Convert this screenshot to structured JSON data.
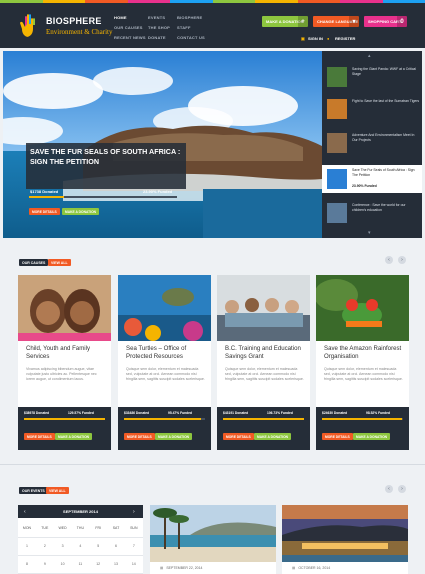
{
  "brand": {
    "name": "BIOSPHERE",
    "tagline": "Environment & Charity"
  },
  "colors": {
    "dark": "#252d38",
    "accent": "#f5b400",
    "green": "#8dc63f",
    "orange": "#f15a24",
    "pink": "#e8318c",
    "stripe": [
      "#8dc63f",
      "#f5b400",
      "#f15a24",
      "#e8318c",
      "#1da1f2",
      "#8dc63f",
      "#f5b400",
      "#f15a24",
      "#e8318c",
      "#1da1f2"
    ]
  },
  "nav": {
    "col1": [
      "HOME",
      "OUR CAUSES",
      "RECENT NEWS"
    ],
    "col2": [
      "EVENTS",
      "THE SHOP",
      "DONATE"
    ],
    "col3": [
      "BIOSPHERE",
      "STAFF",
      "CONTACT US"
    ]
  },
  "header": {
    "donation": "MAKE A DONATION",
    "donation_icon": "+",
    "language": "CHANGE LANGUAGE",
    "language_icon": "▾",
    "cart": "SHOPPING CART",
    "cart_icon": "0",
    "signin": "SIGN IN",
    "register": "REGISTER"
  },
  "hero": {
    "title": "SAVE THE FUR SEALS OF SOUTH AFRICA : SIGN THE PETITION",
    "donated": "$1738 Donated",
    "funded": "23.90% Funded",
    "progress": 0.239,
    "more": "MORE DETAILS",
    "donate": "MAKE A DONATION"
  },
  "slider": {
    "items": [
      {
        "text": "Saving the Giant Panda: WWF at a Critical Stage"
      },
      {
        "text": "Fight to Save the last of the Sumatran Tigers"
      },
      {
        "text": "Adventure And Environmentalism Meet In Our Projects"
      },
      {
        "text": "Save The Fur Seals of South Africa : Sign The Petition",
        "funded": "23.90% Funded"
      },
      {
        "text": "Conference : Save the world for our children's education"
      }
    ]
  },
  "causes": {
    "heading": "OUR CAUSES",
    "view_all": "VIEW ALL",
    "items": [
      {
        "title": "Child, Youth and Family Services",
        "desc": "Vivamus adipiscing bibendum augue, vitae vulputate justo ultricies ac. Pellentesque nec lorem augue, ut condimentum lacus.",
        "donated": "$38978 Donated",
        "funded": "129.57% Funded",
        "progress": 1
      },
      {
        "title": "Sea Turtles – Office of Protected Resources",
        "desc": "Quisque sem dolor, elementum et malesuada sed, vulputate at orci. Aenean commodo nisi fringilla sem, sagittis suscipit sodales scelerisque.",
        "donated": "$33486 Donated",
        "funded": "95.47% Funded",
        "progress": 0.9547
      },
      {
        "title": "B.C. Training and Education Savings Grant",
        "desc": "Quisque sem dolor, elementum et malesuada sed, vulputate at orci. Aenean commodo nisi fringilla sem, sagittis suscipit sodales scelerisque.",
        "donated": "$43191 Donated",
        "funded": "106.73% Funded",
        "progress": 1
      },
      {
        "title": "Save the Amazon Rainforest Organisation",
        "desc": "Quisque sem dolor, elementum et malesuada sed, vulputate at orci. Aenean commodo nisi fringilla sem, sagittis suscipit sodales scelerisque.",
        "donated": "$24630 Donated",
        "funded": "98.52% Funded",
        "progress": 0.9852
      }
    ],
    "more": "MORE DETAILS",
    "donate": "MAKE A DONATION"
  },
  "events": {
    "heading": "OUR EVENTS",
    "view_all": "VIEW ALL",
    "calendar": {
      "month": "SEPTEMBER 2014",
      "days": [
        "MON",
        "TUE",
        "WED",
        "THU",
        "FRI",
        "SAT",
        "SUN"
      ],
      "row1": [
        "1",
        "2",
        "3",
        "4",
        "5",
        "6",
        "7"
      ],
      "row2": [
        "8",
        "9",
        "10",
        "11",
        "12",
        "13",
        "14"
      ],
      "prev": "‹",
      "next": "›"
    },
    "items": [
      {
        "date": "SEPTEMBER 22, 2014"
      },
      {
        "date": "OCTOBER 16, 2014"
      }
    ]
  },
  "arrows": {
    "prev": "‹",
    "next": "›",
    "up": "▴",
    "down": "▾"
  },
  "icons": {
    "calendar": "▦",
    "lock": "🔒",
    "user": "👤"
  }
}
